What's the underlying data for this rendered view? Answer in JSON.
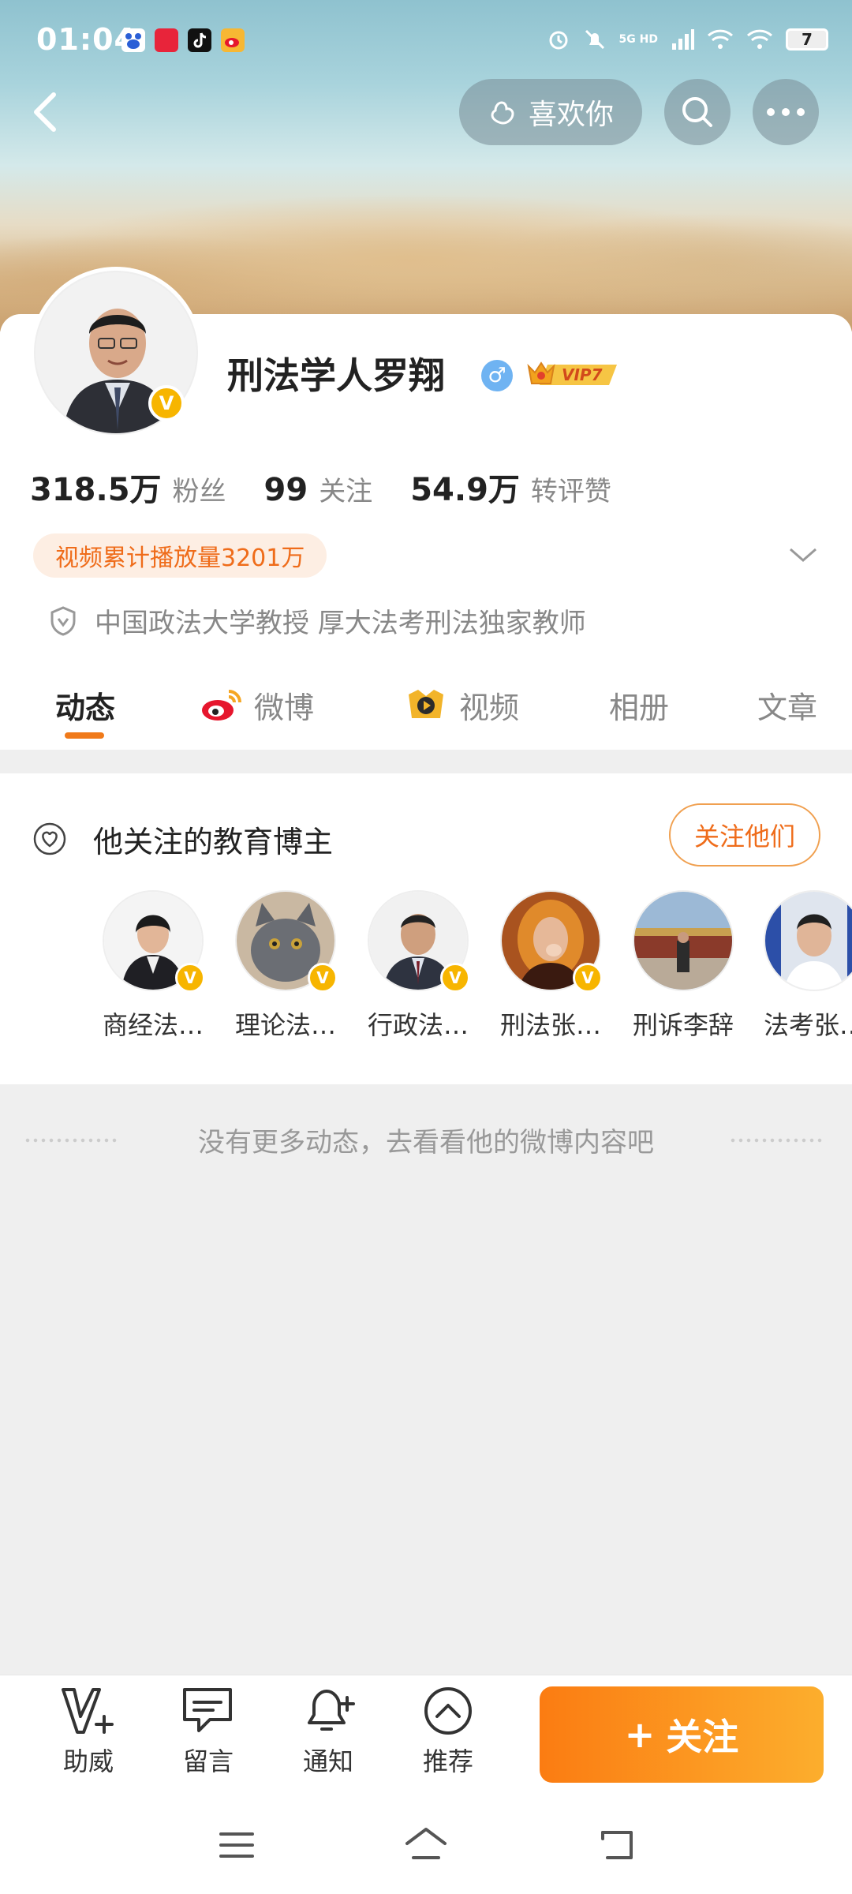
{
  "status_bar": {
    "time": "01:04",
    "network": "5G HD",
    "battery": "7"
  },
  "header": {
    "like_label": "喜欢你"
  },
  "profile": {
    "name": "刑法学人罗翔",
    "gender_symbol": "♂",
    "vip_label": "VIP7",
    "stats": [
      {
        "value": "318.5万",
        "label": "粉丝"
      },
      {
        "value": "99",
        "label": "关注"
      },
      {
        "value": "54.9万",
        "label": "转评赞"
      }
    ],
    "video_plays": "视频累计播放量3201万",
    "bio": "中国政法大学教授 厚大法考刑法独家教师"
  },
  "tabs": [
    {
      "label": "动态"
    },
    {
      "label": "微博"
    },
    {
      "label": "视频"
    },
    {
      "label": "相册"
    },
    {
      "label": "文章"
    }
  ],
  "following_section": {
    "title": "他关注的教育博主",
    "follow_all_label": "关注他们",
    "bloggers": [
      {
        "name": "商经法…"
      },
      {
        "name": "理论法…"
      },
      {
        "name": "行政法…"
      },
      {
        "name": "刑法张…"
      },
      {
        "name": "刑诉李辞"
      },
      {
        "name": "法考张…"
      }
    ]
  },
  "empty_message": "没有更多动态，去看看他的微博内容吧",
  "bottom_bar": {
    "items": [
      {
        "label": "助威"
      },
      {
        "label": "留言"
      },
      {
        "label": "通知"
      },
      {
        "label": "推荐"
      }
    ],
    "follow_label": "关注",
    "follow_plus": "+"
  },
  "colors": {
    "accent": "#f07a1a",
    "badge": "#f7b500",
    "follow_button_start": "#fb7c12",
    "follow_button_end": "#fcae2d"
  }
}
